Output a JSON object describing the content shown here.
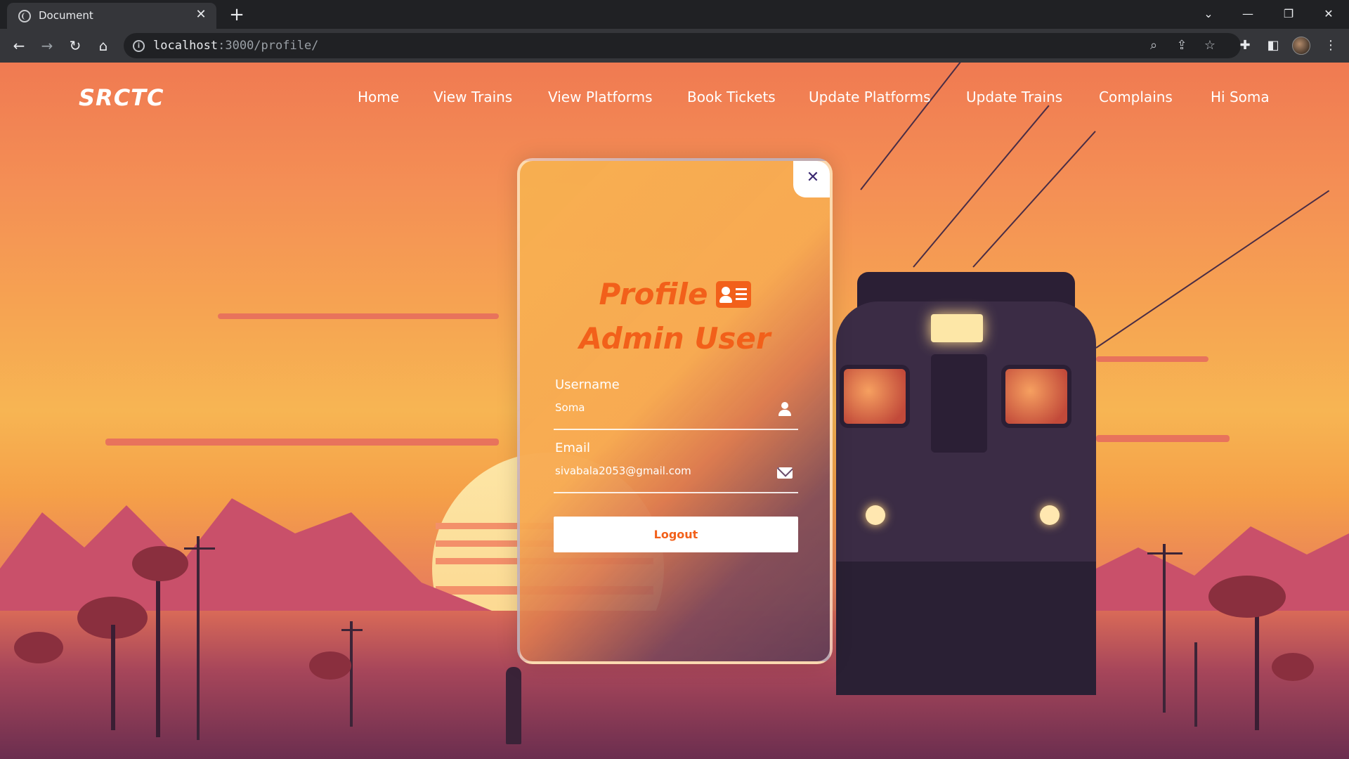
{
  "browser": {
    "tab_title": "Document",
    "tab_close": "✕",
    "new_tab": "+",
    "url_host": "localhost",
    "url_path": ":3000/profile/",
    "window_controls": [
      "⌄",
      "—",
      "❐",
      "✕"
    ]
  },
  "site": {
    "brand": "SRCTC",
    "nav": [
      "Home",
      "View Trains",
      "View Platforms",
      "Book Tickets",
      "Update Platforms",
      "Update Trains",
      "Complains",
      "Hi Soma"
    ]
  },
  "profile": {
    "close": "✕",
    "title": "Profile",
    "subtitle": "Admin User",
    "fields": [
      {
        "label": "Username",
        "value": "Soma",
        "icon": "user-icon"
      },
      {
        "label": "Email",
        "value": "sivabala2053@gmail.com",
        "icon": "envelope-icon"
      }
    ],
    "logout_label": "Logout"
  },
  "colors": {
    "accent": "#f2601a",
    "chrome_dark": "#202124",
    "chrome_mid": "#35363a"
  }
}
